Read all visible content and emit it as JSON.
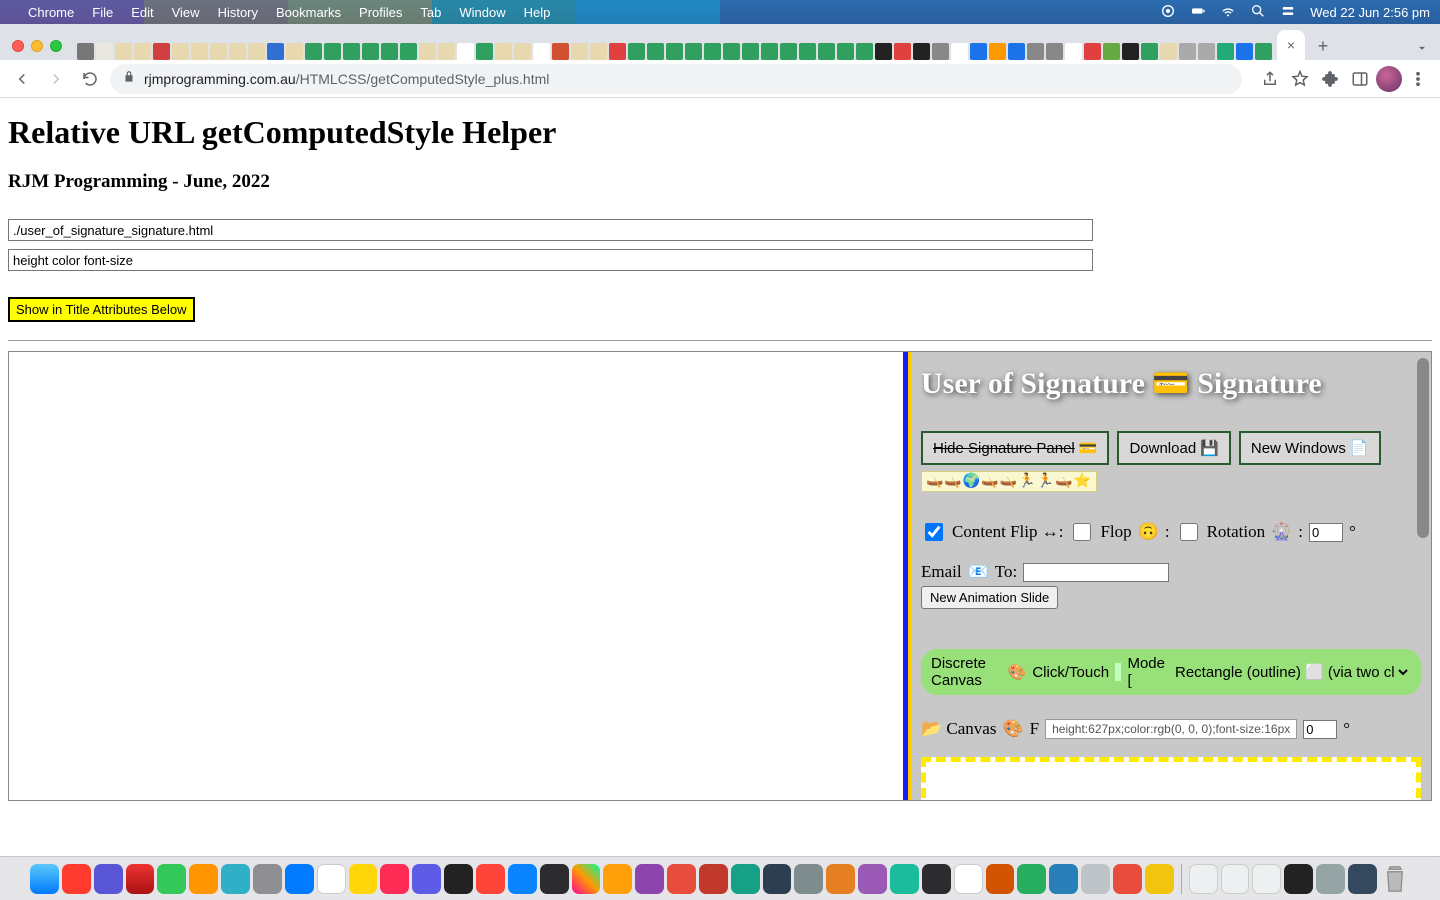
{
  "menubar": {
    "app": "Chrome",
    "items": [
      "File",
      "Edit",
      "View",
      "History",
      "Bookmarks",
      "Profiles",
      "Tab",
      "Window",
      "Help"
    ],
    "clock": "Wed 22 Jun  2:56 pm"
  },
  "browser": {
    "url_host": "rjmprogramming.com.au",
    "url_path": "/HTMLCSS/getComputedStyle_plus.html",
    "newtab_plus": "+",
    "tab_close": "×"
  },
  "page": {
    "h1": "Relative URL getComputedStyle Helper",
    "h3": "RJM Programming - June, 2022",
    "input_url_value": "./user_of_signature_signature.html",
    "input_props_value": "height color font-size",
    "show_button": "Show in Title Attributes Below"
  },
  "sigpanel": {
    "title_pre": "User of Signature ",
    "title_icon": "💳",
    "title_post": " Signature",
    "hide_btn": "Hide Signature Panel",
    "hide_btn_icon": "💳",
    "download_btn": "Download",
    "download_icon": "💾",
    "newwin_btn": "New Windows",
    "newwin_icon": "📄",
    "emoji_strip": "🛶🛶🌍🛶🛶🏃🏃🛶⭐",
    "flip_label": "Content Flip ↔:",
    "flop_label": "Flop",
    "flop_icon": "🙃",
    "flop_colon": ":",
    "rotation_label": "Rotation",
    "rotation_icon": "🎡",
    "rotation_colon": ":",
    "rotation_value": "0",
    "deg_symbol": "°",
    "email_label": "Email",
    "email_icon": "📧",
    "email_to": "To:",
    "new_slide_btn": "New Animation Slide",
    "discrete_label": "Discrete Canvas",
    "palette_icon": "🎨",
    "clicktouch": "Click/Touch",
    "mode_prefix": "Mode [",
    "mode_select": "Rectangle (outline) ⬜ (via two clicks)",
    "canvas_label_pre": "📂 Canvas",
    "canvas_palette": "🎨",
    "canvas_f": "F",
    "tooltip_text": "height:627px;color:rgb(0, 0, 0);font-size:16px",
    "canvas_deg_value": "0"
  }
}
